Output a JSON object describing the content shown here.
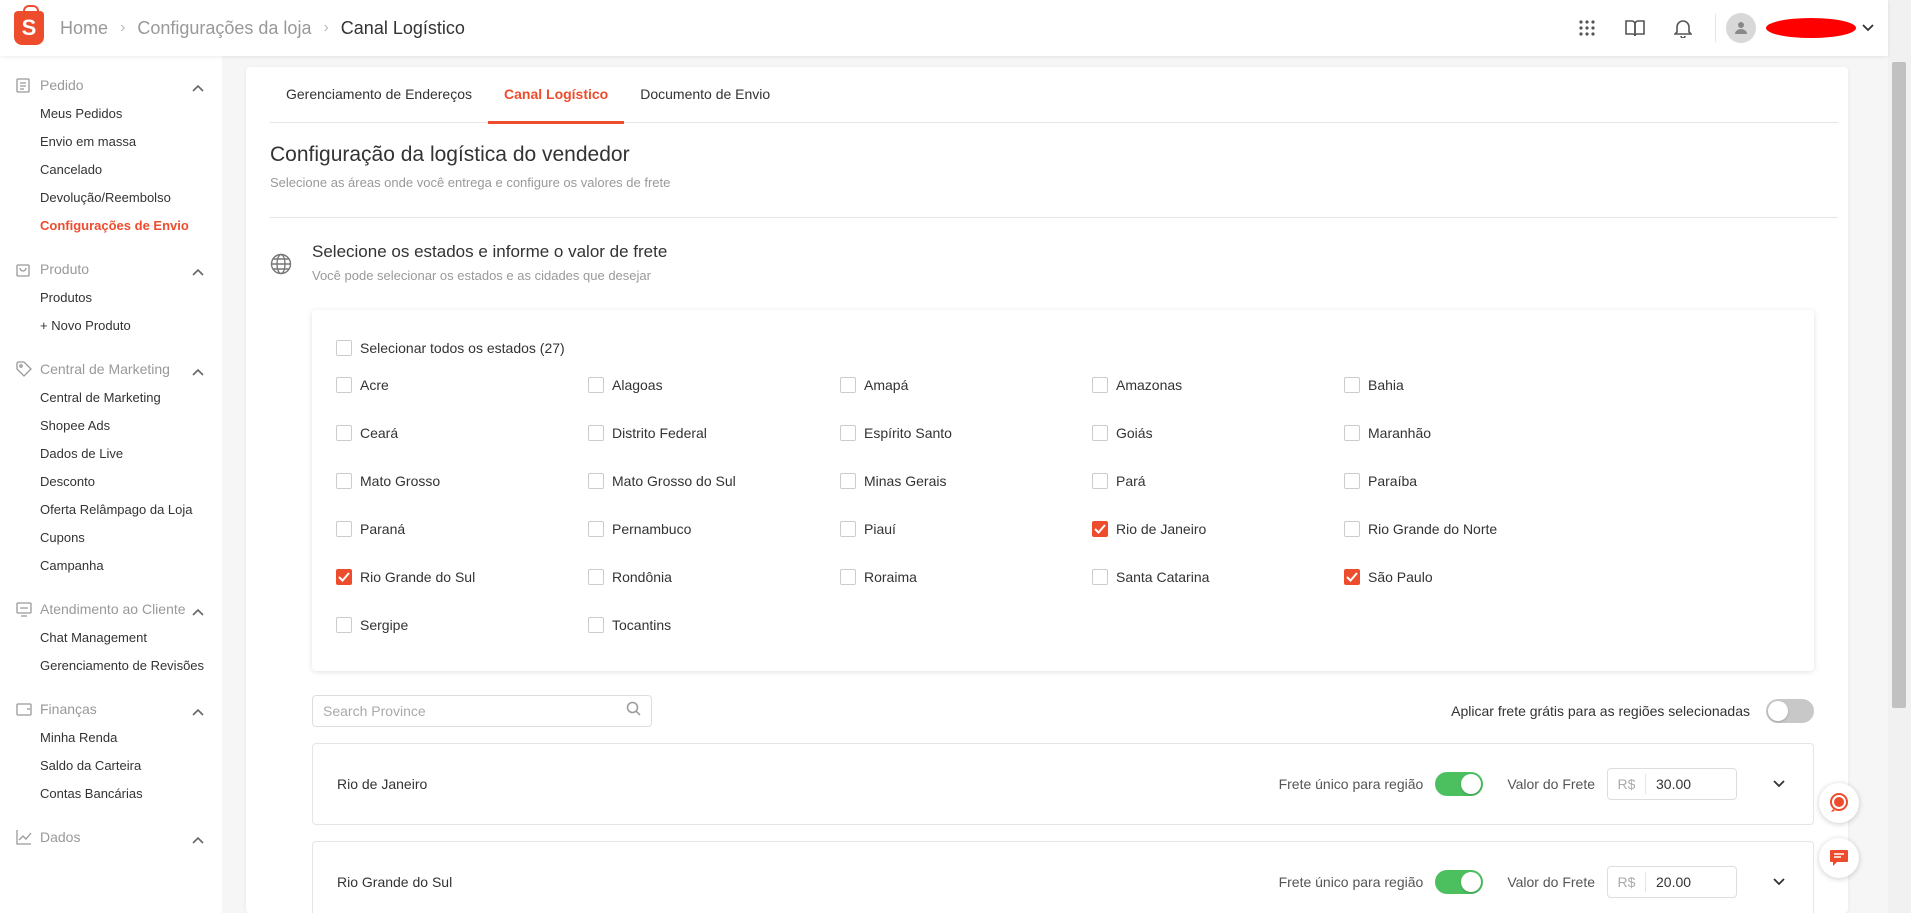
{
  "header": {
    "logo_letter": "S",
    "breadcrumb": [
      "Home",
      "Configurações da loja",
      "Canal Logístico"
    ]
  },
  "sidebar": {
    "groups": [
      {
        "title": "Pedido",
        "icon": "clipboard-icon",
        "items": [
          {
            "label": "Meus Pedidos"
          },
          {
            "label": "Envio em massa"
          },
          {
            "label": "Cancelado"
          },
          {
            "label": "Devolução/Reembolso"
          },
          {
            "label": "Configurações de Envio",
            "active": true
          }
        ]
      },
      {
        "title": "Produto",
        "icon": "bag-icon",
        "items": [
          {
            "label": "Produtos"
          },
          {
            "label": "+ Novo Produto"
          }
        ]
      },
      {
        "title": "Central de Marketing",
        "icon": "tag-icon",
        "items": [
          {
            "label": "Central de Marketing"
          },
          {
            "label": "Shopee Ads"
          },
          {
            "label": "Dados de Live"
          },
          {
            "label": "Desconto"
          },
          {
            "label": "Oferta Relâmpago da Loja"
          },
          {
            "label": "Cupons"
          },
          {
            "label": "Campanha"
          }
        ]
      },
      {
        "title": "Atendimento ao Cliente",
        "icon": "support-icon",
        "items": [
          {
            "label": "Chat Management"
          },
          {
            "label": "Gerenciamento de Revisões"
          }
        ]
      },
      {
        "title": "Finanças",
        "icon": "wallet-icon",
        "items": [
          {
            "label": "Minha Renda"
          },
          {
            "label": "Saldo da Carteira"
          },
          {
            "label": "Contas Bancárias"
          }
        ]
      },
      {
        "title": "Dados",
        "icon": "chart-icon",
        "items": []
      }
    ]
  },
  "tabs": [
    {
      "label": "Gerenciamento de Endereços"
    },
    {
      "label": "Canal Logístico",
      "active": true
    },
    {
      "label": "Documento de Envio"
    }
  ],
  "page": {
    "title": "Configuração da logística do vendedor",
    "subtitle": "Selecione as áreas onde você entrega e configure os valores de frete"
  },
  "states_section": {
    "title": "Selecione os estados e informe o valor de frete",
    "subtitle": "Você pode selecionar os estados e as cidades que desejar",
    "select_all_label": "Selecionar todos os estados (27)",
    "states": [
      {
        "name": "Acre",
        "checked": false
      },
      {
        "name": "Alagoas",
        "checked": false
      },
      {
        "name": "Amapá",
        "checked": false
      },
      {
        "name": "Amazonas",
        "checked": false
      },
      {
        "name": "Bahia",
        "checked": false
      },
      {
        "name": "Ceará",
        "checked": false
      },
      {
        "name": "Distrito Federal",
        "checked": false
      },
      {
        "name": "Espírito Santo",
        "checked": false
      },
      {
        "name": "Goiás",
        "checked": false
      },
      {
        "name": "Maranhão",
        "checked": false
      },
      {
        "name": "Mato Grosso",
        "checked": false
      },
      {
        "name": "Mato Grosso do Sul",
        "checked": false
      },
      {
        "name": "Minas Gerais",
        "checked": false
      },
      {
        "name": "Pará",
        "checked": false
      },
      {
        "name": "Paraíba",
        "checked": false
      },
      {
        "name": "Paraná",
        "checked": false
      },
      {
        "name": "Pernambuco",
        "checked": false
      },
      {
        "name": "Piauí",
        "checked": false
      },
      {
        "name": "Rio de Janeiro",
        "checked": true
      },
      {
        "name": "Rio Grande do Norte",
        "checked": false
      },
      {
        "name": "Rio Grande do Sul",
        "checked": true
      },
      {
        "name": "Rondônia",
        "checked": false
      },
      {
        "name": "Roraima",
        "checked": false
      },
      {
        "name": "Santa Catarina",
        "checked": false
      },
      {
        "name": "São Paulo",
        "checked": true
      },
      {
        "name": "Sergipe",
        "checked": false
      },
      {
        "name": "Tocantins",
        "checked": false
      }
    ]
  },
  "search": {
    "placeholder": "Search Province"
  },
  "free_shipping": {
    "label": "Aplicar frete grátis para as regiões selecionadas",
    "enabled": false
  },
  "regions": [
    {
      "name": "Rio de Janeiro",
      "single_rate_label": "Frete único para região",
      "single_rate": true,
      "fee_label": "Valor do Frete",
      "currency": "R$",
      "fee": "30.00"
    },
    {
      "name": "Rio Grande do Sul",
      "single_rate_label": "Frete único para região",
      "single_rate": true,
      "fee_label": "Valor do Frete",
      "currency": "R$",
      "fee": "20.00"
    }
  ],
  "colors": {
    "accent": "#ee4d2d",
    "toggle_on": "#4cbf5f",
    "toggle_off": "#c8c8c8"
  }
}
